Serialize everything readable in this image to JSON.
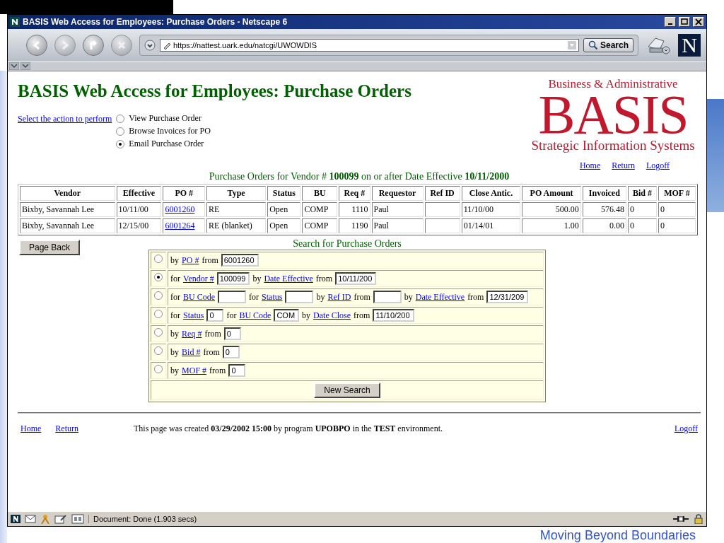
{
  "window": {
    "title": "BASIS Web Access for Employees: Purchase Orders - Netscape 6"
  },
  "toolbar": {
    "url": "https://nattest.uark.edu/natcgi/UWOWDIS",
    "search_button": "Search",
    "brand_mark": "N"
  },
  "page": {
    "heading": "BASIS Web Access for Employees: Purchase Orders",
    "action_prompt": "Select the action to perform",
    "actions": [
      {
        "label": "View Purchase Order",
        "selected": false
      },
      {
        "label": "Browse Invoices for PO",
        "selected": false
      },
      {
        "label": "Email Purchase Order",
        "selected": true
      }
    ],
    "logo": {
      "top": "Business & Administrative",
      "main": "BASIS",
      "bottom": "Strategic Information Systems"
    },
    "top_links": [
      "Home",
      "Return",
      "Logoff"
    ],
    "table_caption": "Purchase Orders for Vendor # **100099** on or after Date Effective **10/11/2000**",
    "table": {
      "columns": [
        {
          "label": "Vendor",
          "kind": "text"
        },
        {
          "label": "Effective",
          "kind": "text"
        },
        {
          "label": "PO #",
          "kind": "link"
        },
        {
          "label": "Type",
          "kind": "text"
        },
        {
          "label": "Status",
          "kind": "text"
        },
        {
          "label": "BU",
          "kind": "text"
        },
        {
          "label": "Req #",
          "kind": "number"
        },
        {
          "label": "Requestor",
          "kind": "text"
        },
        {
          "label": "Ref ID",
          "kind": "text"
        },
        {
          "label": "Close Antic.",
          "kind": "text"
        },
        {
          "label": "PO Amount",
          "kind": "number"
        },
        {
          "label": "Invoiced",
          "kind": "number"
        },
        {
          "label": "Bid #",
          "kind": "text"
        },
        {
          "label": "MOF #",
          "kind": "text"
        }
      ],
      "rows": [
        [
          "Bixby, Savannah Lee",
          "10/11/00",
          "6001260",
          "RE",
          "Open",
          "COMP",
          "1110",
          "Paul",
          null,
          "11/10/00",
          "500.00",
          "576.48",
          "0",
          "0"
        ],
        [
          "Bixby, Savannah Lee",
          "12/15/00",
          "6001264",
          "RE (blanket)",
          "Open",
          "COMP",
          "1190",
          "Paul",
          null,
          "01/14/01",
          "1.00",
          "0.00",
          "0",
          "0"
        ]
      ]
    },
    "page_back": "Page Back",
    "search": {
      "title": "Search for Purchase Orders",
      "rows": [
        {
          "selected": false,
          "parts": [
            {
              "kind": "text",
              "text": "by"
            },
            {
              "kind": "link",
              "text": "PO #"
            },
            {
              "kind": "text",
              "text": "from"
            },
            {
              "kind": "field",
              "value": "6001260"
            }
          ]
        },
        {
          "selected": true,
          "parts": [
            {
              "kind": "text",
              "text": "for"
            },
            {
              "kind": "link",
              "text": "Vendor #"
            },
            {
              "kind": "field",
              "value": "100099"
            },
            {
              "kind": "text",
              "text": "by"
            },
            {
              "kind": "link",
              "text": "Date Effective"
            },
            {
              "kind": "text",
              "text": "from"
            },
            {
              "kind": "field",
              "value": "10/11/200"
            }
          ]
        },
        {
          "selected": false,
          "parts": [
            {
              "kind": "text",
              "text": "for"
            },
            {
              "kind": "link",
              "text": "BU Code"
            },
            {
              "kind": "field"
            },
            {
              "kind": "text",
              "text": "for"
            },
            {
              "kind": "link",
              "text": "Status"
            },
            {
              "kind": "field"
            },
            {
              "kind": "text",
              "text": "by"
            },
            {
              "kind": "link",
              "text": "Ref ID"
            },
            {
              "kind": "text",
              "text": "from"
            },
            {
              "kind": "field"
            },
            {
              "kind": "text",
              "text": "by"
            },
            {
              "kind": "link",
              "text": "Date Effective"
            },
            {
              "kind": "text",
              "text": "from"
            },
            {
              "kind": "field",
              "value": "12/31/209"
            }
          ]
        },
        {
          "selected": false,
          "parts": [
            {
              "kind": "text",
              "text": "for"
            },
            {
              "kind": "link",
              "text": "Status"
            },
            {
              "kind": "field",
              "value": "0"
            },
            {
              "kind": "text",
              "text": "for"
            },
            {
              "kind": "link",
              "text": "BU Code"
            },
            {
              "kind": "field",
              "value": "COM"
            },
            {
              "kind": "text",
              "text": "by"
            },
            {
              "kind": "link",
              "text": "Date Close"
            },
            {
              "kind": "text",
              "text": "from"
            },
            {
              "kind": "field",
              "value": "11/10/200"
            }
          ]
        },
        {
          "selected": false,
          "parts": [
            {
              "kind": "text",
              "text": "by"
            },
            {
              "kind": "link",
              "text": "Req #"
            },
            {
              "kind": "text",
              "text": "from"
            },
            {
              "kind": "field",
              "value": "0"
            }
          ]
        },
        {
          "selected": false,
          "parts": [
            {
              "kind": "text",
              "text": "by"
            },
            {
              "kind": "link",
              "text": "Bid #"
            },
            {
              "kind": "text",
              "text": "from"
            },
            {
              "kind": "field",
              "value": "0"
            }
          ]
        },
        {
          "selected": false,
          "parts": [
            {
              "kind": "text",
              "text": "by"
            },
            {
              "kind": "link",
              "text": "MOF #"
            },
            {
              "kind": "text",
              "text": "from"
            },
            {
              "kind": "field",
              "value": "0"
            }
          ]
        }
      ],
      "button": "New Search"
    },
    "footer": {
      "links": [
        "Home",
        "Return"
      ],
      "note": "This page was created **03/29/2002 15:00** by program **UPOBPO** in the **TEST** environment.",
      "logoff": "Logoff"
    }
  },
  "status_bar": {
    "text": "Document: Done (1.903 secs)"
  },
  "slide": {
    "tagline": "Moving Beyond Boundaries"
  }
}
